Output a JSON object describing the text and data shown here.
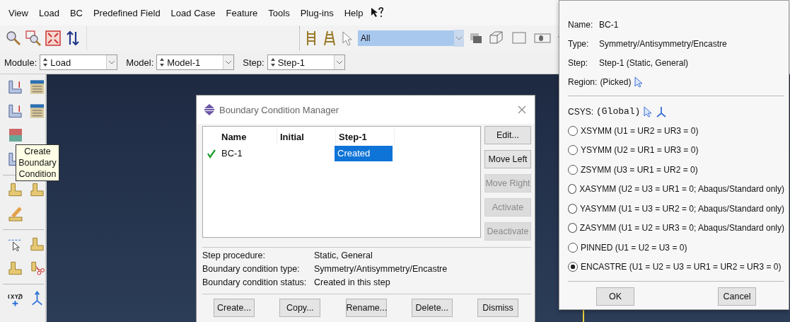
{
  "menu": [
    "View",
    "Load",
    "BC",
    "Predefined Field",
    "Load Case",
    "Feature",
    "Tools",
    "Plug-ins",
    "Help"
  ],
  "selection_filter": {
    "value": "All"
  },
  "context_bar": [
    {
      "label": "Module:",
      "value": "Load"
    },
    {
      "label": "Model:",
      "value": "Model-1"
    },
    {
      "label": "Step:",
      "value": "Step-1"
    }
  ],
  "tooltip": "Create Boundary Condition",
  "manager": {
    "title": "Boundary Condition Manager",
    "columns": [
      "Name",
      "Initial",
      "Step-1"
    ],
    "rows": [
      {
        "active": true,
        "name": "BC-1",
        "step_1": "Created",
        "selected": true
      }
    ],
    "side_buttons": [
      {
        "label": "Edit...",
        "disabled": false
      },
      {
        "label": "Move Left",
        "disabled": false
      },
      {
        "label": "Move Right",
        "disabled": true
      },
      {
        "label": "Activate",
        "disabled": true
      },
      {
        "label": "Deactivate",
        "disabled": true
      }
    ],
    "info": [
      {
        "label": "Step procedure:",
        "value": "Static, General"
      },
      {
        "label": "Boundary condition type:",
        "value": "Symmetry/Antisymmetry/Encastre"
      },
      {
        "label": "Boundary condition status:",
        "value": "Created in this step"
      }
    ],
    "buttons": [
      "Create...",
      "Copy...",
      "Rename...",
      "Delete...",
      "Dismiss"
    ]
  },
  "edit_dialog": {
    "fields": [
      {
        "label": "Name:",
        "value": "BC-1"
      },
      {
        "label": "Type:",
        "value": "Symmetry/Antisymmetry/Encastre"
      },
      {
        "label": "Step:",
        "value": "Step-1 (Static, General)"
      }
    ],
    "region": {
      "label": "Region:",
      "value": "(Picked)"
    },
    "csys": {
      "label": "CSYS:",
      "value": "(Global)"
    },
    "options": [
      {
        "label": "XSYMM (U1 = UR2 = UR3 = 0)",
        "selected": false
      },
      {
        "label": "YSYMM (U2 = UR1 = UR3 = 0)",
        "selected": false
      },
      {
        "label": "ZSYMM (U3 = UR1 = UR2 = 0)",
        "selected": false
      },
      {
        "label": "XASYMM (U2 = U3 = UR1 = 0; Abaqus/Standard only)",
        "selected": false
      },
      {
        "label": "YASYMM (U1 = U3 = UR2 = 0; Abaqus/Standard only)",
        "selected": false
      },
      {
        "label": "ZASYMM (U1 = U2 = UR3 = 0; Abaqus/Standard only)",
        "selected": false
      },
      {
        "label": "PINNED (U1 = U2 = U3 = 0)",
        "selected": false
      },
      {
        "label": "ENCASTRE (U1 = U2 = U3 = UR1 = UR2 = UR3 = 0)",
        "selected": true
      }
    ],
    "buttons": [
      "OK",
      "Cancel"
    ]
  }
}
